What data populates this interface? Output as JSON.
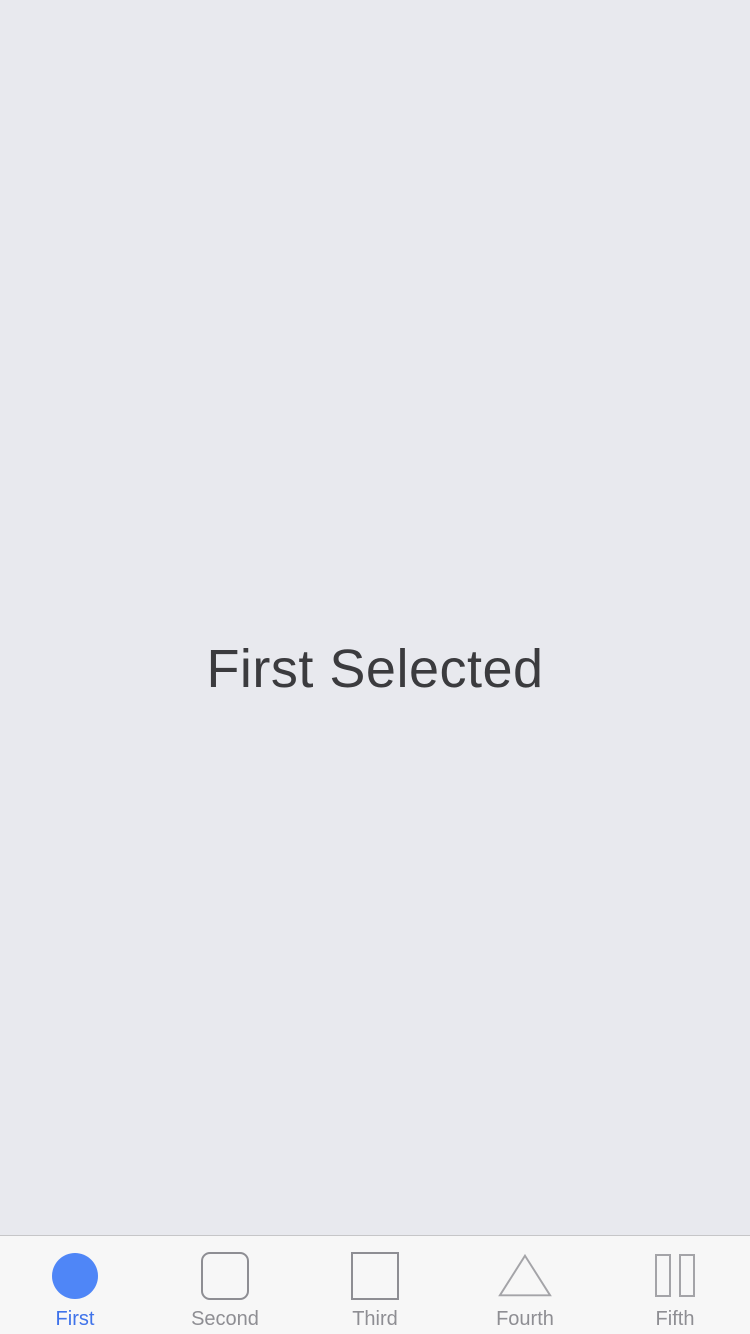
{
  "main": {
    "selected_text": "First Selected"
  },
  "tabbar": {
    "active_index": 0,
    "active_color": "#4f86f7",
    "active_label_color": "#3f73ea",
    "inactive_color": "#8e8e93",
    "items": [
      {
        "label": "First",
        "icon": "filled-circle-icon"
      },
      {
        "label": "Second",
        "icon": "rounded-square-icon"
      },
      {
        "label": "Third",
        "icon": "square-icon"
      },
      {
        "label": "Fourth",
        "icon": "triangle-icon"
      },
      {
        "label": "Fifth",
        "icon": "pause-bars-icon"
      }
    ]
  }
}
